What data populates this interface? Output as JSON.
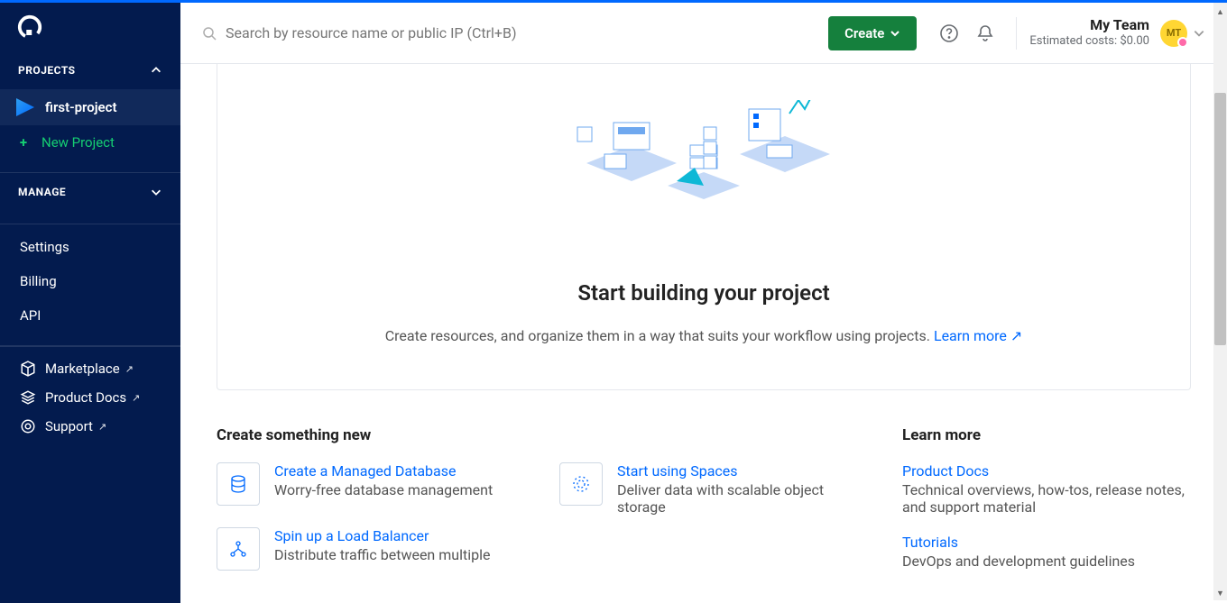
{
  "header": {
    "search_placeholder": "Search by resource name or public IP (Ctrl+B)",
    "create_label": "Create",
    "team_name": "My Team",
    "cost_label": "Estimated costs: $0.00",
    "avatar_initials": "MT"
  },
  "sidebar": {
    "projects_label": "PROJECTS",
    "project_name": "first-project",
    "new_project_label": "New Project",
    "manage_label": "MANAGE",
    "links": {
      "settings": "Settings",
      "billing": "Billing",
      "api": "API"
    },
    "bottom": {
      "marketplace": "Marketplace",
      "product_docs": "Product Docs",
      "support": "Support"
    }
  },
  "hero": {
    "title": "Start building your project",
    "subtitle_prefix": "Create resources, and organize them in a way that suits your workflow using projects. ",
    "learn_more": "Learn more"
  },
  "create_section": {
    "title": "Create something new",
    "items": [
      {
        "title": "Create a Managed Database",
        "desc": "Worry-free database management"
      },
      {
        "title": "Spin up a Load Balancer",
        "desc": "Distribute traffic between multiple"
      },
      {
        "title": "Start using Spaces",
        "desc": "Deliver data with scalable object storage"
      }
    ]
  },
  "learn_section": {
    "title": "Learn more",
    "items": [
      {
        "title": "Product Docs",
        "desc": "Technical overviews, how-tos, release notes, and support material"
      },
      {
        "title": "Tutorials",
        "desc": "DevOps and development guidelines"
      }
    ]
  }
}
